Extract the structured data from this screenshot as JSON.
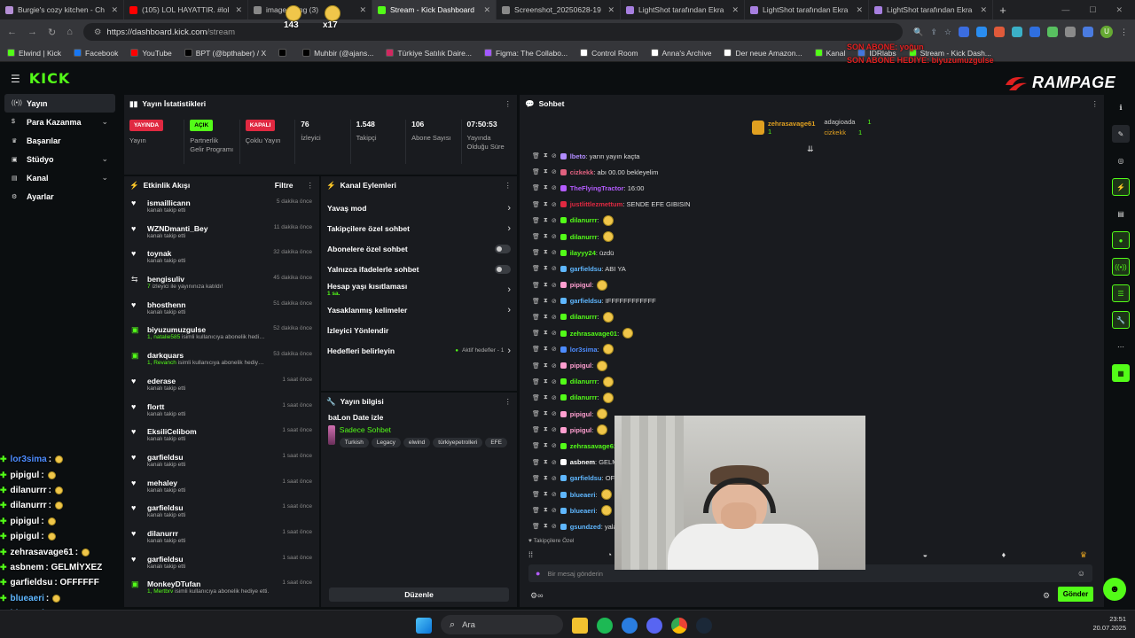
{
  "browser": {
    "tabs": [
      {
        "title": "Burgie's cozy kitchen - Ch",
        "color": "#b58fd6"
      },
      {
        "title": "(105) LOL HAYATTIR. #lol",
        "color": "#ff0000"
      },
      {
        "title": "image_thing (3)",
        "color": "#888888"
      },
      {
        "title": "Stream - Kick Dashboard",
        "color": "#53fc18",
        "active": true
      },
      {
        "title": "Screenshot_20250628-19",
        "color": "#888888"
      },
      {
        "title": "LightShot tarafından Ekra",
        "color": "#a77fe0"
      },
      {
        "title": "LightShot tarafından Ekra",
        "color": "#a77fe0"
      },
      {
        "title": "LightShot tarafından Ekra",
        "color": "#a77fe0"
      }
    ],
    "new_tab": "+",
    "url_host": "https://dashboard.kick.com",
    "url_path": "/stream",
    "profile_letter": "U",
    "bookmarks": [
      {
        "label": "Elwind | Kick",
        "color": "#53fc18"
      },
      {
        "label": "Facebook",
        "color": "#1877f2"
      },
      {
        "label": "YouTube",
        "color": "#ff0000"
      },
      {
        "label": "BPT (@bpthaber) / X",
        "color": "#000000"
      },
      {
        "label": "",
        "color": "#000000"
      },
      {
        "label": "Muhbir (@ajans...",
        "color": "#000000"
      },
      {
        "label": "Türkiye Satılık Daire...",
        "color": "#d02860"
      },
      {
        "label": "Figma: The Collabo...",
        "color": "#a259ff"
      },
      {
        "label": "Control Room",
        "color": "#ffffff"
      },
      {
        "label": "Anna's Archive",
        "color": "#ffffff"
      },
      {
        "label": "Der neue Amazon...",
        "color": "#ffffff"
      },
      {
        "label": "Kanal",
        "color": "#53fc18"
      },
      {
        "label": "IDRlabs",
        "color": "#4477dd"
      },
      {
        "label": "Stream - Kick Dash...",
        "color": "#53fc18"
      }
    ]
  },
  "overlay": {
    "emote_counts": [
      "143",
      "x17"
    ],
    "son_abone": "SON ABONE: yoğun",
    "son_abone_hediye": "SON ABONE HEDİYE: biyuzumuzgulse",
    "brand": "RAMPAGE"
  },
  "kick": {
    "logo": "KICK",
    "sidebar": [
      {
        "label": "Yayın",
        "icon": "broadcast-icon",
        "active": true,
        "chev": false
      },
      {
        "label": "Para Kazanma",
        "icon": "money-icon",
        "chev": true
      },
      {
        "label": "Başarılar",
        "icon": "trophy-icon",
        "chev": false
      },
      {
        "label": "Stüdyo",
        "icon": "studio-icon",
        "chev": true
      },
      {
        "label": "Kanal",
        "icon": "channel-icon",
        "chev": true
      },
      {
        "label": "Ayarlar",
        "icon": "gear-icon",
        "chev": false
      }
    ],
    "stats": {
      "title": "Yayın İstatistikleri",
      "items": [
        {
          "badge": "YAYINDA",
          "badge_color": "red",
          "label": "Yayın"
        },
        {
          "badge": "AÇIK",
          "badge_color": "green",
          "label": "Partnerlik Gelir Programı"
        },
        {
          "badge": "KAPALI",
          "badge_color": "red",
          "label": "Çoklu Yayın"
        },
        {
          "value": "76",
          "label": "İzleyici"
        },
        {
          "value": "1.548",
          "label": "Takipçi"
        },
        {
          "value": "106",
          "label": "Abone Sayısı"
        },
        {
          "value": "07:50:53",
          "label": "Yayında Olduğu Süre"
        }
      ]
    },
    "activity": {
      "title": "Etkinlik Akışı",
      "filter": "Filtre",
      "items": [
        {
          "user": "ismaillicann",
          "sub": "kanalı takip etti",
          "time": "5 dakika önce",
          "type": "follow"
        },
        {
          "user": "WZNDmanti_Bey",
          "sub": "kanalı takip etti",
          "time": "11 dakika önce",
          "type": "follow"
        },
        {
          "user": "toynak",
          "sub": "kanalı takip etti",
          "time": "32 dakika önce",
          "type": "follow"
        },
        {
          "user": "bengisuliv",
          "sub_hl": "7",
          "sub": "izleyici ile yayınınıza katıldı!",
          "time": "45 dakika önce",
          "type": "raid"
        },
        {
          "user": "bhosthenn",
          "sub": "kanalı takip etti",
          "time": "51 dakika önce",
          "type": "follow"
        },
        {
          "user": "biyuzumuzgulse",
          "sub_hl": "1, natalie585",
          "sub": "isimli kullanıcıya abonelik hediye etti.",
          "time": "52 dakika önce",
          "type": "gift"
        },
        {
          "user": "darkquars",
          "sub_hl": "1, Revanch",
          "sub": "isimli kullanıcıya abonelik hediye etti.",
          "time": "53 dakika önce",
          "type": "gift"
        },
        {
          "user": "ederase",
          "sub": "kanalı takip etti",
          "time": "1 saat önce",
          "type": "follow"
        },
        {
          "user": "flortt",
          "sub": "kanalı takip etti",
          "time": "1 saat önce",
          "type": "follow"
        },
        {
          "user": "EksiliCelibom",
          "sub": "kanalı takip etti",
          "time": "1 saat önce",
          "type": "follow"
        },
        {
          "user": "garfieldsu",
          "sub": "kanalı takip etti",
          "time": "1 saat önce",
          "type": "follow"
        },
        {
          "user": "mehaley",
          "sub": "kanalı takip etti",
          "time": "1 saat önce",
          "type": "follow"
        },
        {
          "user": "garfieldsu",
          "sub": "kanalı takip etti",
          "time": "1 saat önce",
          "type": "follow"
        },
        {
          "user": "dilanurrr",
          "sub": "kanalı takip etti",
          "time": "1 saat önce",
          "type": "follow"
        },
        {
          "user": "garfieldsu",
          "sub": "kanalı takip etti",
          "time": "1 saat önce",
          "type": "follow"
        },
        {
          "user": "MonkeyDTufan",
          "sub_hl": "1, Mertbrv",
          "sub": "isimli kullanıcıya abonelik hediye etti.",
          "time": "1 saat önce",
          "type": "gift"
        }
      ]
    },
    "channel_actions": {
      "title": "Kanal Eylemleri",
      "items": [
        {
          "label": "Yavaş mod",
          "right": "chev"
        },
        {
          "label": "Takipçilere özel sohbet",
          "right": "chev"
        },
        {
          "label": "Abonelere özel sohbet",
          "right": "toggle"
        },
        {
          "label": "Yalnızca ifadelerle sohbet",
          "right": "toggle"
        },
        {
          "label": "Hesap yaşı kısıtlaması",
          "sub": "1 sa.",
          "right": "chev"
        },
        {
          "label": "Yasaklanmış kelimeler",
          "right": "chev"
        },
        {
          "label": "İzleyici Yönlendir",
          "right": ""
        },
        {
          "label": "Hedefleri belirleyin",
          "right": "chev",
          "status": "Aktif hedefler - 1"
        }
      ]
    },
    "stream_info": {
      "title": "Yayın bilgisi",
      "stream_title": "baLon Date izle",
      "category": "Sadece Sohbet",
      "tags": [
        "Turkish",
        "Legacy",
        "elwind",
        "türkiyepetrolleri",
        "EFE"
      ],
      "edit": "Düzenle"
    },
    "chat": {
      "title": "Sohbet",
      "top_gifter": {
        "name": "zehrasavage61",
        "count": "1"
      },
      "gifters": [
        {
          "name": "adagioada",
          "count": "1"
        },
        {
          "name": "cizkekk",
          "count": "1"
        }
      ],
      "messages": [
        {
          "user": "lbeto",
          "color": "#b18cff",
          "text": ": yarın yayın kaçta",
          "emote": false
        },
        {
          "user": "cizkekk",
          "color": "#e0617f",
          "text": ": abı 00.00 bekleyelim",
          "emote": false
        },
        {
          "user": "TheFlyingTractor",
          "color": "#b45cff",
          "text": ": 16:00",
          "emote": false
        },
        {
          "user": "justlittlezmettum",
          "color": "#e02941",
          "text": ": SENDE EFE GIBISIN",
          "emote": false
        },
        {
          "user": "dilanurrr",
          "color": "#53fc18",
          "text": ":",
          "emote": true
        },
        {
          "user": "dilanurrr",
          "color": "#53fc18",
          "text": ":",
          "emote": true
        },
        {
          "user": "ilayyy24",
          "color": "#53fc18",
          "text": ": üzdü",
          "emote": false
        },
        {
          "user": "garfieldsu",
          "color": "#5fb7ff",
          "text": ": ABI YA",
          "emote": false
        },
        {
          "user": "pipigul",
          "color": "#ff9fd0",
          "text": ":",
          "emote": true
        },
        {
          "user": "garfieldsu",
          "color": "#5fb7ff",
          "text": ": IFFFFFFFFFFFF",
          "emote": false
        },
        {
          "user": "dilanurrr",
          "color": "#53fc18",
          "text": ":",
          "emote": true
        },
        {
          "user": "zehrasavage01",
          "color": "#53fc18",
          "text": ":",
          "emote": true
        },
        {
          "user": "lor3sima",
          "color": "#4d8cff",
          "text": ":",
          "emote": true
        },
        {
          "user": "pipigul",
          "color": "#ff9fd0",
          "text": ":",
          "emote": true
        },
        {
          "user": "dilanurrr",
          "color": "#53fc18",
          "text": ":",
          "emote": true
        },
        {
          "user": "dilanurrr",
          "color": "#53fc18",
          "text": ":",
          "emote": true
        },
        {
          "user": "pipigul",
          "color": "#ff9fd0",
          "text": ":",
          "emote": true
        },
        {
          "user": "pipigul",
          "color": "#ff9fd0",
          "text": ":",
          "emote": true
        },
        {
          "user": "zehrasavage61",
          "color": "#53fc18",
          "text": ":",
          "emote": true
        },
        {
          "user": "asbnem",
          "color": "#ffffff",
          "text": ": GELMİYXEZ",
          "emote": false
        },
        {
          "user": "garfieldsu",
          "color": "#5fb7ff",
          "text": ": OFFFFFF",
          "emote": false
        },
        {
          "user": "blueaeri",
          "color": "#5fb7ff",
          "text": ":",
          "emote": true
        },
        {
          "user": "blueaeri",
          "color": "#5fb7ff",
          "text": ":",
          "emote": true
        },
        {
          "user": "gsundzed",
          "color": "#5fb7ff",
          "text": ": yalancıyı skmiyorlar ya",
          "emote": false
        }
      ],
      "followers_only": "Takipçilere Özel",
      "input_placeholder": "Bir mesaj gönderin",
      "send": "Gönder"
    }
  },
  "overlay_chat": [
    {
      "user": "lor3sima",
      "color": "#4d8cff",
      "text": ":",
      "emote": true
    },
    {
      "user": "pipigul",
      "color": "#ffffff",
      "text": ":",
      "emote": true
    },
    {
      "user": "dilanurrr",
      "color": "#ffffff",
      "text": ":",
      "emote": true
    },
    {
      "user": "dilanurrr",
      "color": "#ffffff",
      "text": ":",
      "emote": true
    },
    {
      "user": "pipigul",
      "color": "#ffffff",
      "text": ":",
      "emote": true
    },
    {
      "user": "pipigul",
      "color": "#ffffff",
      "text": ":",
      "emote": true
    },
    {
      "user": "zehrasavage61",
      "color": "#ffffff",
      "text": ":",
      "emote": true
    },
    {
      "user": "asbnem",
      "color": "#ffffff",
      "text": ": GELMİYXEZ",
      "emote": false
    },
    {
      "user": "garfieldsu",
      "color": "#ffffff",
      "text": ": OFFFFFF",
      "emote": false
    },
    {
      "user": "blueaeri",
      "color": "#5fb7ff",
      "text": ":",
      "emote": true
    },
    {
      "user": "blueaeri",
      "color": "#5fb7ff",
      "text": ":",
      "emote": true
    },
    {
      "user": "gsundzed",
      "color": "#5fb7ff",
      "text": ": yalancıyı skmiyorlar ya",
      "emote": false
    }
  ],
  "taskbar": {
    "search": "Ara",
    "time": "23:51",
    "date": "20.07.2025"
  }
}
